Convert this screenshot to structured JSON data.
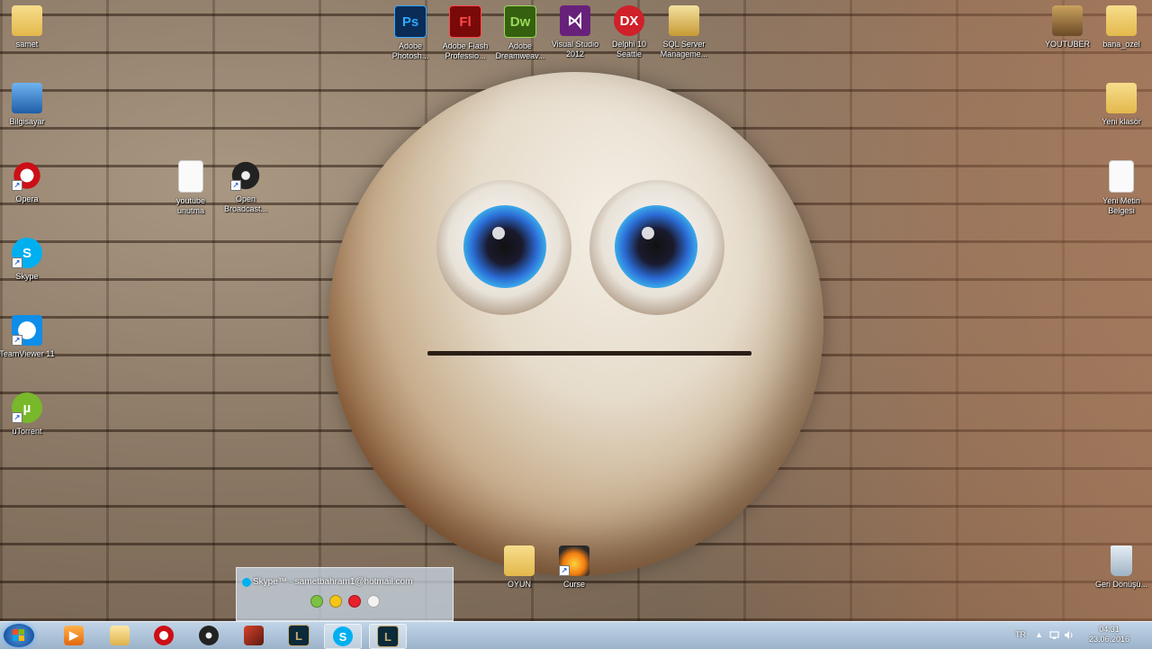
{
  "desktop_icons": {
    "samet": "samet",
    "computer": "Bilgisayar",
    "opera": "Opera",
    "skype": "Skype",
    "teamviewer": "TeamViewer 11",
    "utorrent": "uTorrent",
    "youtube_unutma": "youtube unutma",
    "obs": "Open Broadcast...",
    "photoshop": "Adobe Photosh...",
    "flash": "Adobe Flash Professio...",
    "dreamweaver": "Adobe Dreamweav...",
    "visual_studio": "Visual Studio 2012",
    "delphi": "Delphi 10 Seattle",
    "sql_server": "SQL Server Manageme...",
    "youtuber": "YOUTUBER",
    "bana_ozel": "bana_ozel",
    "yeni_klasor": "Yeni klasör",
    "yeni_metin": "Yeni Metin Belgesi",
    "oyun": "OYUN",
    "curse": "Curse",
    "recycle_bin": "Geri Dönüşü..."
  },
  "icon_glyphs": {
    "photoshop": "Ps",
    "flash": "Fl",
    "dreamweaver": "Dw",
    "delphi": "DX"
  },
  "skype_popup": {
    "title": "Skype™ - sametbahram1@hotmail.com"
  },
  "taskbar": {
    "language": "TR",
    "time": "04:31",
    "date": "23.06.2016"
  },
  "colors": {
    "photoshop": "#0a2c57",
    "flash": "#7a0a0a",
    "dreamweaver": "#35600f",
    "visual_studio": "#68217a",
    "delphi": "#d0202a",
    "skype": "#00aff0",
    "opera": "#cc0f16"
  }
}
